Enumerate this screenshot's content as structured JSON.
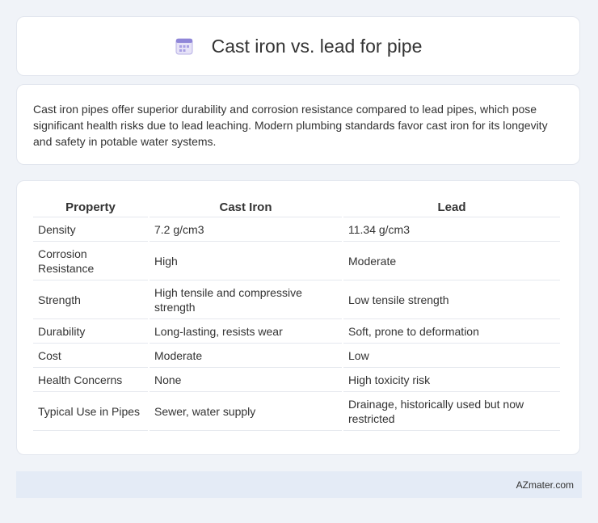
{
  "title": {
    "icon": "calendar-icon",
    "text": "Cast iron vs. lead for pipe"
  },
  "intro": {
    "text": "Cast iron pipes offer superior durability and corrosion resistance compared to lead pipes, which pose significant health risks due to lead leaching. Modern plumbing standards favor cast iron for its longevity and safety in potable water systems."
  },
  "table": {
    "headers": [
      "Property",
      "Cast Iron",
      "Lead"
    ],
    "rows": [
      [
        "Density",
        "7.2 g/cm3",
        "11.34 g/cm3"
      ],
      [
        "Corrosion Resistance",
        "High",
        "Moderate"
      ],
      [
        "Strength",
        "High tensile and compressive strength",
        "Low tensile strength"
      ],
      [
        "Durability",
        "Long-lasting, resists wear",
        "Soft, prone to deformation"
      ],
      [
        "Cost",
        "Moderate",
        "Low"
      ],
      [
        "Health Concerns",
        "None",
        "High toxicity risk"
      ],
      [
        "Typical Use in Pipes",
        "Sewer, water supply",
        "Drainage, historically used but now restricted"
      ]
    ]
  },
  "footer": {
    "text": "AZmater.com"
  }
}
